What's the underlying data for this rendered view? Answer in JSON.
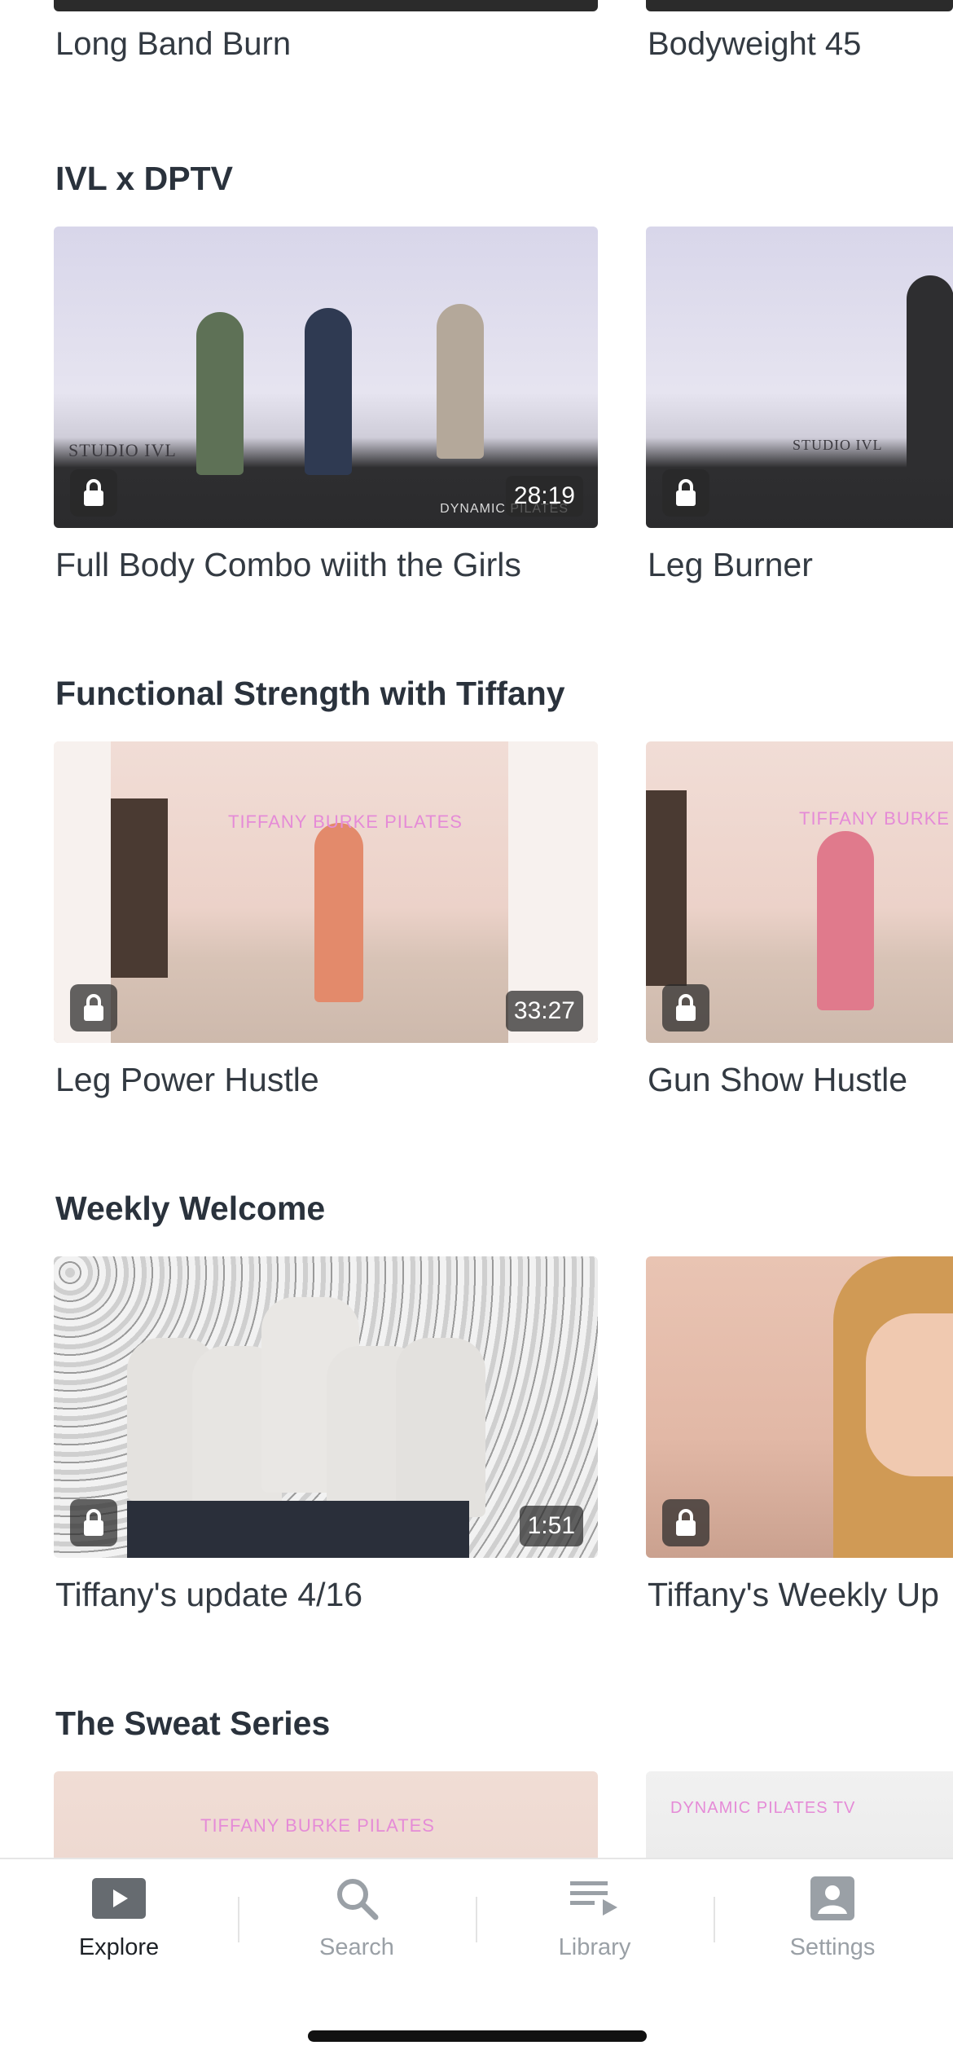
{
  "top_row": {
    "items": [
      {
        "title": "Long Band Burn"
      },
      {
        "title": "Bodyweight 45"
      }
    ]
  },
  "sections": [
    {
      "title": "IVL x DPTV",
      "items": [
        {
          "title": "Full Body Combo wiith the Girls",
          "duration": "28:19",
          "locked": true,
          "caption": "STUDIO IVL",
          "watermark": "DYNAMIC PILATES"
        },
        {
          "title": "Leg Burner",
          "locked": true,
          "caption": "STUDIO IVL"
        }
      ]
    },
    {
      "title": "Functional Strength with Tiffany",
      "items": [
        {
          "title": "Leg Power Hustle",
          "duration": "33:27",
          "locked": true,
          "caption": "TIFFANY BURKE PILATES"
        },
        {
          "title": "Gun Show Hustle",
          "locked": true,
          "caption": "TIFFANY BURKE"
        }
      ]
    },
    {
      "title": "Weekly Welcome",
      "items": [
        {
          "title": "Tiffany's update 4/16",
          "duration": "1:51",
          "locked": true
        },
        {
          "title": "Tiffany's Weekly Up",
          "locked": true
        }
      ]
    },
    {
      "title": "The Sweat Series",
      "items": [
        {
          "caption": "TIFFANY BURKE PILATES"
        },
        {
          "caption": "DYNAMIC PILATES TV"
        }
      ]
    }
  ],
  "tabbar": {
    "tabs": [
      {
        "label": "Explore",
        "icon": "play-icon",
        "active": true
      },
      {
        "label": "Search",
        "icon": "search-icon",
        "active": false
      },
      {
        "label": "Library",
        "icon": "library-icon",
        "active": false
      },
      {
        "label": "Settings",
        "icon": "settings-icon",
        "active": false
      }
    ]
  },
  "colors": {
    "active_tab": "#1d2126",
    "inactive_tab": "#9aa0a6",
    "overlay": "#282828"
  }
}
